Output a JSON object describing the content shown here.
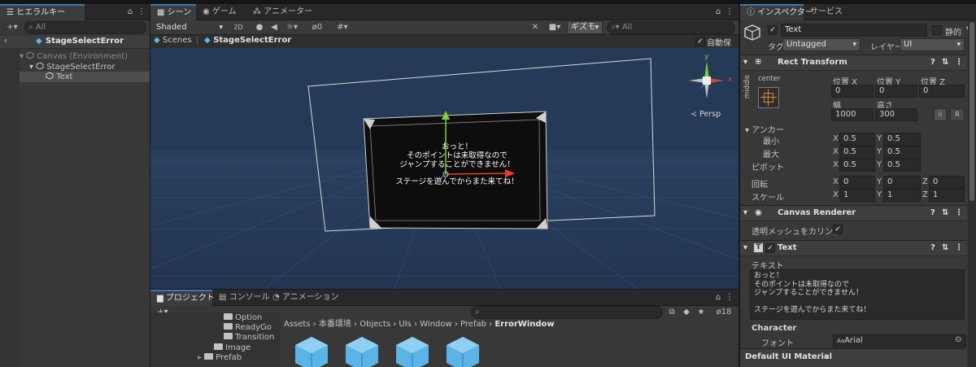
{
  "hierarchy": {
    "tab": "ヒエラルキー",
    "search_placeholder": "All",
    "scene_title": "StageSelectError",
    "items": [
      "Canvas (Environment)",
      "StageSelectError",
      "Text"
    ]
  },
  "scene": {
    "tabs": [
      "シーン",
      "ゲーム",
      "アニメーター"
    ],
    "shading": "Shaded",
    "mode_2d": "2D",
    "vis_count": "0",
    "gizmos": "ギズモ",
    "search_placeholder": "All",
    "breadcrumb_root": "Scenes",
    "breadcrumb_current": "StageSelectError",
    "autosave": "自動保存",
    "persp": "Persp",
    "gizmo_x": "x",
    "gizmo_y": "y",
    "dialog_lines": [
      "おっと！",
      "そのポイントは未取得なので",
      "ジャンプすることができません！",
      "",
      "ステージを遊んでからまた来てね！"
    ]
  },
  "project": {
    "tabs": [
      "プロジェクト",
      "コンソール",
      "アニメーション"
    ],
    "badge_count": "18",
    "breadcrumb": [
      "Assets",
      "本番環境",
      "Objects",
      "UIs",
      "Window",
      "Prefab",
      "ErrorWindow"
    ],
    "folders": [
      "Option",
      "ReadyGo",
      "Transition",
      "Image",
      "Prefab"
    ]
  },
  "inspector": {
    "tabs": [
      "インスペクター",
      "サービス"
    ],
    "object_name": "Text",
    "static_label": "静的",
    "tag_label": "タグ",
    "tag_value": "Untagged",
    "layer_label": "レイヤー",
    "layer_value": "UI",
    "rect_transform": {
      "title": "Rect Transform",
      "anchor_h": "center",
      "anchor_v": "middle",
      "pos_x_label": "位置 X",
      "pos_y_label": "位置 Y",
      "pos_z_label": "位置 Z",
      "pos_x": "0",
      "pos_y": "0",
      "pos_z": "0",
      "width_label": "幅",
      "height_label": "高さ",
      "width": "1000",
      "height": "300",
      "r_label": "R",
      "anchors_label": "アンカー",
      "min_label": "最小",
      "max_label": "最大",
      "min_x": "0.5",
      "min_y": "0.5",
      "max_x": "0.5",
      "max_y": "0.5",
      "pivot_label": "ピボット",
      "pivot_x": "0.5",
      "pivot_y": "0.5",
      "rotation_label": "回転",
      "rot_x": "0",
      "rot_y": "0",
      "rot_z": "0",
      "scale_label": "スケール",
      "scale_x": "1",
      "scale_y": "1",
      "scale_z": "1",
      "axis_x": "X",
      "axis_y": "Y",
      "axis_z": "Z"
    },
    "canvas_renderer": {
      "title": "Canvas Renderer",
      "cull_label": "透明メッシュをカリング"
    },
    "text_component": {
      "title": "Text",
      "text_label": "テキスト",
      "text_lines": [
        "おっと！",
        "そのポイントは未取得なので",
        "ジャンプすることができません！",
        "",
        "ステージを遊んでからまた来てね！"
      ],
      "character_label": "Character",
      "font_label": "フォント",
      "font_prefix": "Aa",
      "font_value": "Arial"
    },
    "material": "Default UI Material"
  },
  "colors": {
    "accent": "#3a79bb",
    "scene_bg": "#243a56"
  }
}
